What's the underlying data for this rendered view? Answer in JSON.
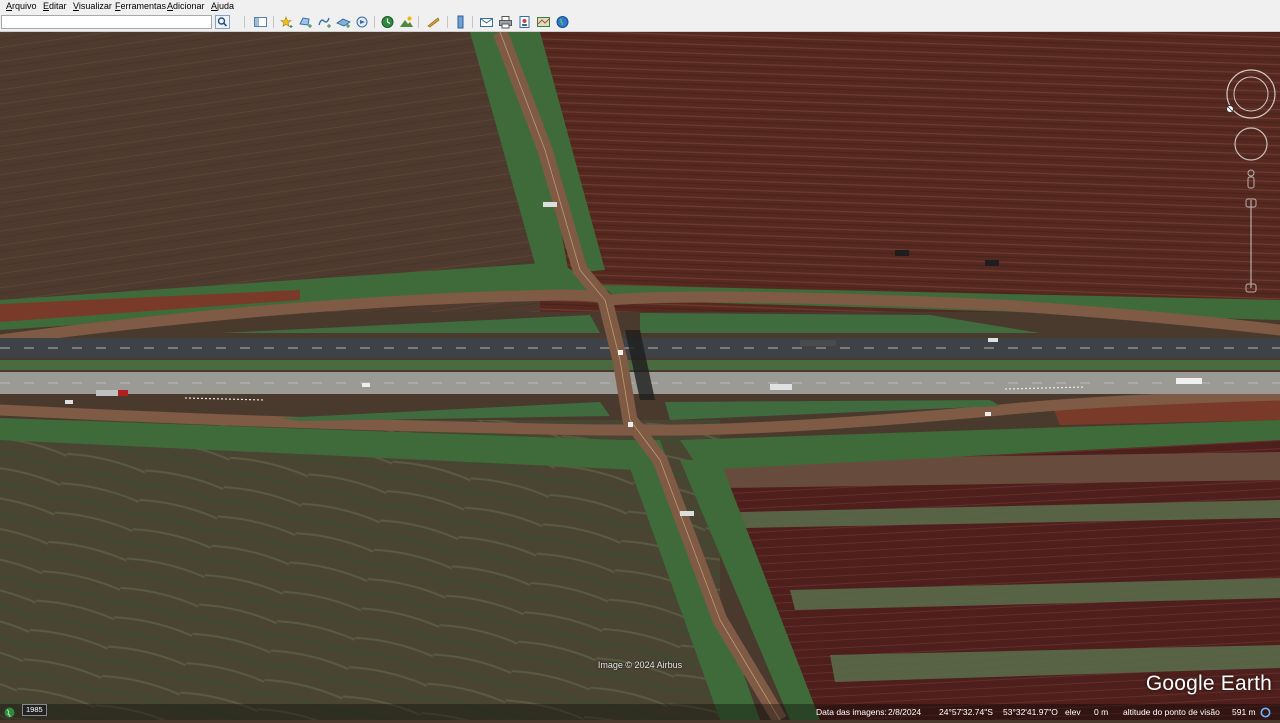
{
  "menu": {
    "items": [
      "Arquivo",
      "Editar",
      "Visualizar",
      "Ferramentas",
      "Adicionar",
      "Ajuda"
    ]
  },
  "toolbar": {
    "search_value": "",
    "buttons": [
      "search-icon",
      "sidebar-toggle-icon",
      "placemark-icon",
      "polygon-icon",
      "path-icon",
      "image-overlay-icon",
      "record-tour-icon",
      "historical-imagery-icon",
      "sunlight-icon",
      "planets-icon",
      "ruler-icon",
      "email-icon",
      "print-icon",
      "save-image-icon",
      "maps-icon",
      "earth-icon"
    ]
  },
  "map": {
    "attribution": "Image © 2024 Airbus",
    "logo": "Google Earth"
  },
  "status": {
    "year": "1985",
    "date_label": "Data das imagens:",
    "date": "2/8/2024",
    "lat": "24°57'32.74\"S",
    "lon": "53°32'41.97\"O",
    "elev_label": "elev",
    "elev": "0 m",
    "eye_label": "altitude do ponto de visão",
    "eye": "591 m"
  },
  "colors": {
    "dirt_road": "#7f5a44",
    "highway": "#3e4145",
    "concrete_lane": "#9c9a94",
    "median_grass": "#3f6b3e",
    "plowed_field": "#5a2a22",
    "pasture": "#4b4a38",
    "ui_bar": "#f0f0f0"
  }
}
